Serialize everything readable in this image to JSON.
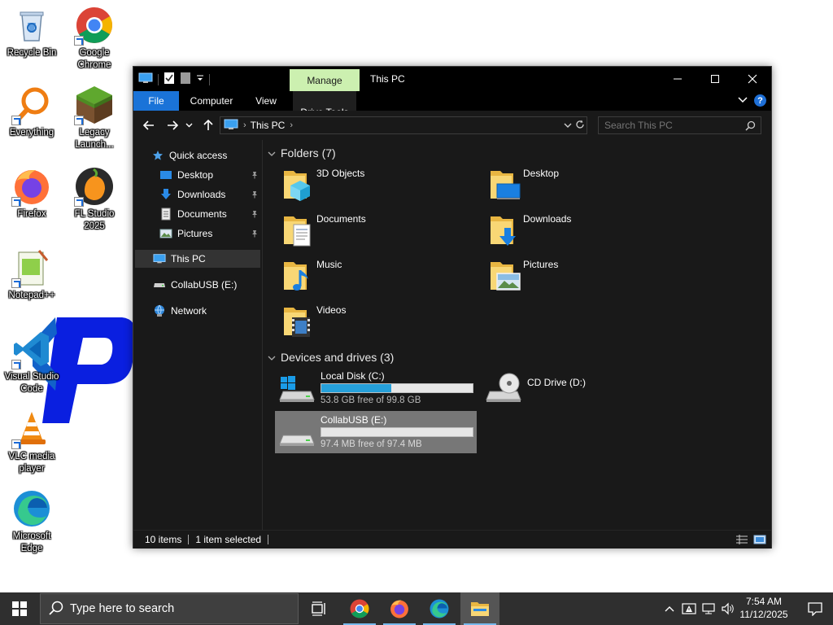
{
  "desktop": {
    "icons": [
      {
        "label": "Recycle Bin",
        "icon": "recycle-bin-icon"
      },
      {
        "label": "Google Chrome",
        "icon": "chrome-icon"
      },
      {
        "label": "Everything",
        "icon": "everything-icon"
      },
      {
        "label": "Legacy Launch...",
        "icon": "minecraft-icon"
      },
      {
        "label": "Firefox",
        "icon": "firefox-icon"
      },
      {
        "label": "FL Studio 2025",
        "icon": "fl-studio-icon"
      },
      {
        "label": "Notepad++",
        "icon": "notepad-plus-plus-icon"
      },
      {
        "label": "Visual Studio Code",
        "icon": "vscode-icon"
      },
      {
        "label": "VLC media player",
        "icon": "vlc-icon"
      },
      {
        "label": "Microsoft Edge",
        "icon": "edge-icon"
      }
    ]
  },
  "explorer": {
    "title": "This PC",
    "contextual_tab": "Manage",
    "ribbon_tabs": [
      "File",
      "Computer",
      "View",
      "Drive Tools"
    ],
    "address": {
      "crumb": "This PC"
    },
    "search": {
      "placeholder": "Search This PC"
    },
    "nav": {
      "quick_access": "Quick access",
      "pinned": [
        {
          "label": "Desktop",
          "icon": "desktop-folder-icon"
        },
        {
          "label": "Downloads",
          "icon": "downloads-folder-icon"
        },
        {
          "label": "Documents",
          "icon": "documents-folder-icon"
        },
        {
          "label": "Pictures",
          "icon": "pictures-folder-icon"
        }
      ],
      "this_pc": "This PC",
      "usb": "CollabUSB (E:)",
      "network": "Network"
    },
    "folders_header": "Folders (7)",
    "folders": [
      {
        "name": "3D Objects",
        "icon": "3d-objects-folder-icon"
      },
      {
        "name": "Desktop",
        "icon": "desktop-folder-icon"
      },
      {
        "name": "Documents",
        "icon": "documents-folder-icon"
      },
      {
        "name": "Downloads",
        "icon": "downloads-folder-icon"
      },
      {
        "name": "Music",
        "icon": "music-folder-icon"
      },
      {
        "name": "Pictures",
        "icon": "pictures-folder-icon"
      },
      {
        "name": "Videos",
        "icon": "videos-folder-icon"
      }
    ],
    "devices_header": "Devices and drives (3)",
    "drives": [
      {
        "name": "Local Disk (C:)",
        "free": "53.8 GB free of 99.8 GB",
        "used_fraction": 0.46,
        "icon": "windows-drive-icon"
      },
      {
        "name": "CD Drive (D:)",
        "icon": "cd-drive-icon"
      },
      {
        "name": "CollabUSB (E:)",
        "free": "97.4 MB free of 97.4 MB",
        "used_fraction": 0.0,
        "icon": "usb-drive-icon",
        "selected": true
      }
    ],
    "status": {
      "items": "10 items",
      "selected": "1 item selected"
    }
  },
  "taskbar": {
    "search_placeholder": "Type here to search",
    "apps": [
      "task-view",
      "chrome",
      "firefox",
      "edge",
      "file-explorer"
    ],
    "time": "7:54 AM",
    "date": "11/12/2025"
  },
  "colors": {
    "accent": "#1a73d8",
    "manage_tab": "#ccf0b0",
    "drive_bar": "#26a0da",
    "window_bg": "#191919"
  }
}
